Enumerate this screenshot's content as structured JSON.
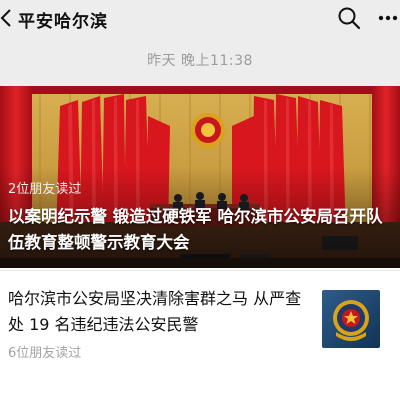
{
  "header": {
    "title": "平安哈尔滨",
    "back_icon": "back-chevron-icon",
    "search_icon": "search-icon",
    "more_icon": "more-dots-icon"
  },
  "timestamp": "昨天 晚上11:38",
  "feed": {
    "hero_article": {
      "friends_read": "2位朋友读过",
      "title": "以案明纪示警 锻造过硬铁军  哈尔滨市公安局召开队伍教育整顿警示教育大会"
    },
    "article2": {
      "title": "哈尔滨市公安局坚决清除害群之马 从严查处 19 名违纪违法公安民警",
      "friends_read": "6位朋友读过",
      "thumbnail_icon": "police-emblem-icon"
    }
  },
  "colors": {
    "background": "#ededed",
    "card": "#ffffff",
    "stage_red": "#c8161d",
    "emblem_gold": "#d9a21b"
  }
}
